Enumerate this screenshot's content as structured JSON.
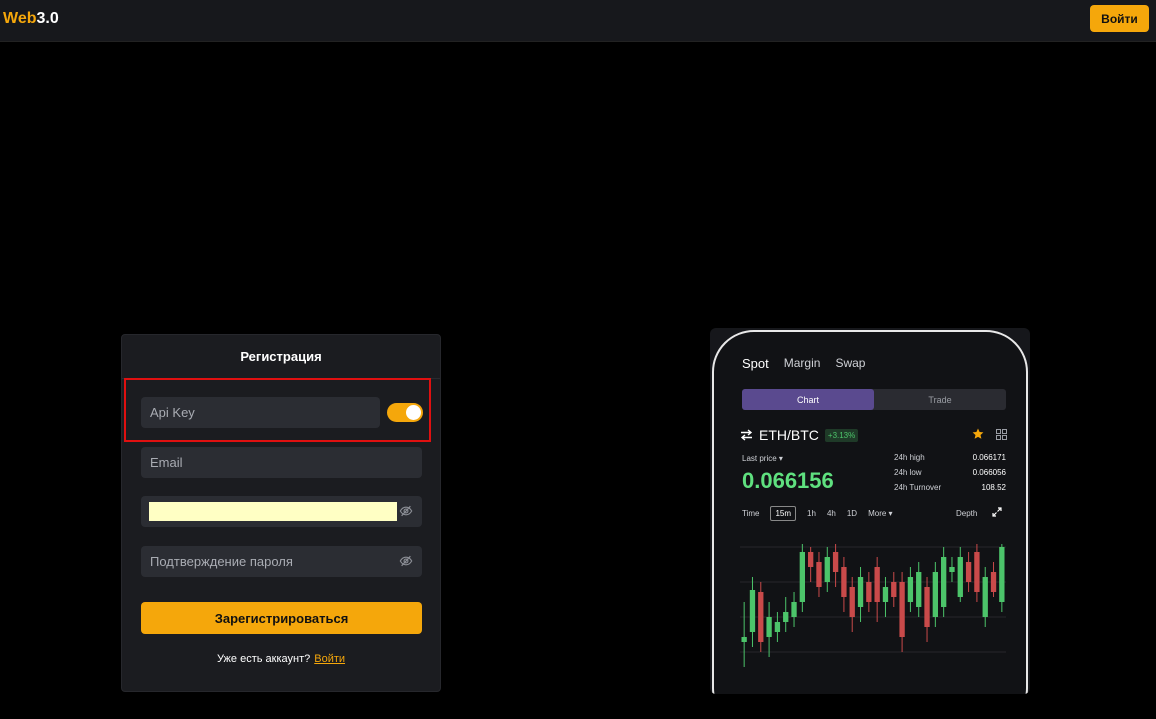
{
  "header": {
    "logo_part1": "Web",
    "logo_part2": "3.0",
    "login_label": "Войти"
  },
  "register": {
    "title": "Регистрация",
    "api_key_placeholder": "Api Key",
    "api_toggle_on": true,
    "email_placeholder": "Email",
    "password_value": "",
    "confirm_placeholder": "Подтверждение пароля",
    "submit_label": "Зарегистрироваться",
    "have_account": "Уже есть аккаунт?",
    "login_link": "Войти"
  },
  "phone": {
    "tabs": [
      "Spot",
      "Margin",
      "Swap"
    ],
    "segments": [
      "Chart",
      "Trade"
    ],
    "pair": "ETH/BTC",
    "change": "+3.13%",
    "last_price_label": "Last price",
    "last_price": "0.066156",
    "stats": [
      {
        "label": "24h high",
        "value": "0.066171"
      },
      {
        "label": "24h low",
        "value": "0.066056"
      },
      {
        "label": "24h Turnover",
        "value": "108.52"
      }
    ],
    "timeframes": [
      "Time",
      "15m",
      "1h",
      "4h",
      "1D",
      "More"
    ],
    "selected_timeframe": "15m",
    "depth_label": "Depth",
    "colors": {
      "up": "#4cc46a",
      "down": "#c94a4a",
      "accent": "#f5a70b"
    }
  }
}
